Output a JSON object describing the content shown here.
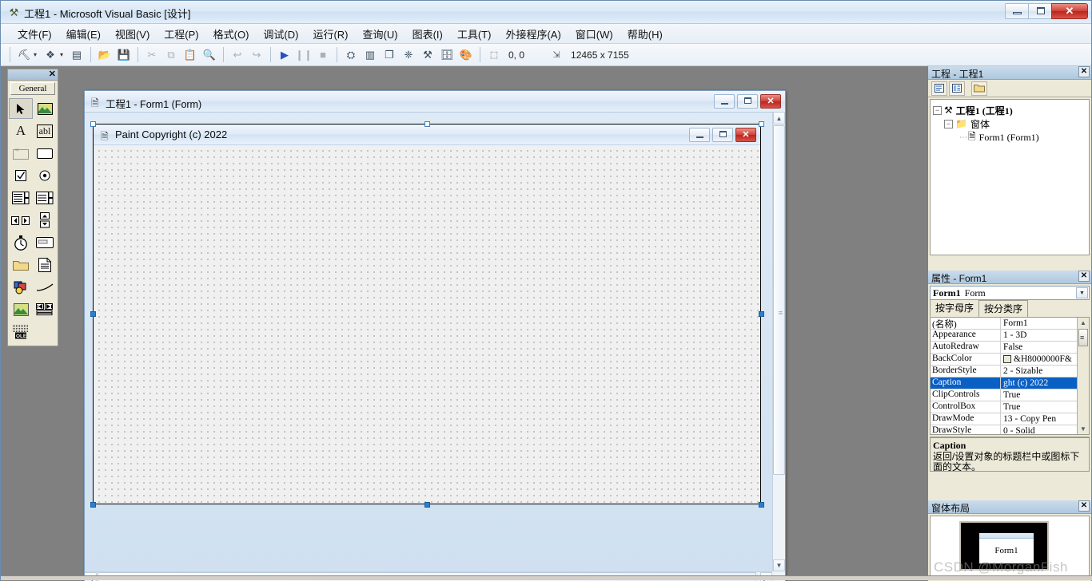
{
  "window": {
    "title": "工程1 - Microsoft Visual Basic [设计]",
    "icon": "vb-app-icon",
    "minimize_label": "",
    "maximize_label": "",
    "close_label": "✕"
  },
  "menubar": {
    "items": [
      {
        "label": "文件(F)",
        "name": "menu-file"
      },
      {
        "label": "编辑(E)",
        "name": "menu-edit"
      },
      {
        "label": "视图(V)",
        "name": "menu-view"
      },
      {
        "label": "工程(P)",
        "name": "menu-project"
      },
      {
        "label": "格式(O)",
        "name": "menu-format"
      },
      {
        "label": "调试(D)",
        "name": "menu-debug"
      },
      {
        "label": "运行(R)",
        "name": "menu-run"
      },
      {
        "label": "查询(U)",
        "name": "menu-query"
      },
      {
        "label": "图表(I)",
        "name": "menu-diagram"
      },
      {
        "label": "工具(T)",
        "name": "menu-tools"
      },
      {
        "label": "外接程序(A)",
        "name": "menu-addins"
      },
      {
        "label": "窗口(W)",
        "name": "menu-window"
      },
      {
        "label": "帮助(H)",
        "name": "menu-help"
      }
    ]
  },
  "toolbar": {
    "buttons": [
      {
        "name": "add-project-button",
        "glyph": "⛏",
        "dim": false,
        "dropdown": true
      },
      {
        "name": "add-form-button",
        "glyph": "❖",
        "dim": false,
        "dropdown": true
      },
      {
        "name": "menu-editor-button",
        "glyph": "▤",
        "dim": false,
        "dropdown": false
      },
      {
        "name": "open-project-button",
        "glyph": "📂",
        "dim": false,
        "dropdown": false
      },
      {
        "name": "save-project-button",
        "glyph": "💾",
        "dim": false,
        "dropdown": false
      },
      {
        "name": "cut-button",
        "glyph": "✂",
        "dim": true,
        "dropdown": false
      },
      {
        "name": "copy-button",
        "glyph": "⧉",
        "dim": true,
        "dropdown": false
      },
      {
        "name": "paste-button",
        "glyph": "📋",
        "dim": true,
        "dropdown": false
      },
      {
        "name": "find-button",
        "glyph": "🔍",
        "dim": true,
        "dropdown": false
      },
      {
        "name": "undo-button",
        "glyph": "↩",
        "dim": true,
        "dropdown": false
      },
      {
        "name": "redo-button",
        "glyph": "↪",
        "dim": true,
        "dropdown": false
      },
      {
        "name": "start-button",
        "glyph": "▶",
        "dim": false,
        "dropdown": false
      },
      {
        "name": "break-button",
        "glyph": "❙❙",
        "dim": true,
        "dropdown": false
      },
      {
        "name": "end-button",
        "glyph": "■",
        "dim": true,
        "dropdown": false
      },
      {
        "name": "project-explorer-button",
        "glyph": "⛭",
        "dim": false,
        "dropdown": false
      },
      {
        "name": "properties-window-button",
        "glyph": "▥",
        "dim": false,
        "dropdown": false
      },
      {
        "name": "form-layout-button",
        "glyph": "❐",
        "dim": false,
        "dropdown": false
      },
      {
        "name": "object-browser-button",
        "glyph": "❈",
        "dim": false,
        "dropdown": false
      },
      {
        "name": "toolbox-button",
        "glyph": "⚒",
        "dim": false,
        "dropdown": false
      },
      {
        "name": "data-view-button",
        "glyph": "🗄",
        "dim": false,
        "dropdown": false
      },
      {
        "name": "visual-component-manager-button",
        "glyph": "🎨",
        "dim": false,
        "dropdown": false
      }
    ],
    "position_icon": "position-icon",
    "position_value": "0, 0",
    "size_icon": "size-icon",
    "size_value": "12465 x 7155"
  },
  "toolbox": {
    "panel_title": "",
    "close_label": "✕",
    "tab_label": "General",
    "tools": [
      {
        "name": "tool-pointer",
        "glyph": "➚",
        "selected": true
      },
      {
        "name": "tool-picturebox",
        "glyph": "🖼",
        "selected": false
      },
      {
        "name": "tool-label",
        "glyph": "A",
        "selected": false
      },
      {
        "name": "tool-textbox",
        "glyph": "abl",
        "selected": false
      },
      {
        "name": "tool-frame",
        "glyph": "xy",
        "selected": false
      },
      {
        "name": "tool-commandbutton",
        "glyph": "▭",
        "selected": false
      },
      {
        "name": "tool-checkbox",
        "glyph": "☑",
        "selected": false
      },
      {
        "name": "tool-optionbutton",
        "glyph": "◉",
        "selected": false
      },
      {
        "name": "tool-combobox",
        "glyph": "▤",
        "selected": false
      },
      {
        "name": "tool-listbox",
        "glyph": "▤",
        "selected": false
      },
      {
        "name": "tool-hscrollbar",
        "glyph": "◀▶",
        "selected": false
      },
      {
        "name": "tool-vscrollbar",
        "glyph": "▲▼",
        "selected": false
      },
      {
        "name": "tool-timer",
        "glyph": "⏱",
        "selected": false
      },
      {
        "name": "tool-drivelistbox",
        "glyph": "▤",
        "selected": false
      },
      {
        "name": "tool-dirlistbox",
        "glyph": "📁",
        "selected": false
      },
      {
        "name": "tool-filelistbox",
        "glyph": "📄",
        "selected": false
      },
      {
        "name": "tool-shape",
        "glyph": "◔",
        "selected": false
      },
      {
        "name": "tool-line",
        "glyph": "╲",
        "selected": false
      },
      {
        "name": "tool-image",
        "glyph": "🖼",
        "selected": false
      },
      {
        "name": "tool-data",
        "glyph": "◀▶",
        "selected": false
      },
      {
        "name": "tool-ole",
        "glyph": "OLE",
        "selected": false
      }
    ]
  },
  "designer": {
    "window_title": "工程1 - Form1 (Form)",
    "window_icon": "form-document-icon",
    "minimize_label": "",
    "maximize_label": "",
    "close_label": "✕",
    "form": {
      "caption": "Paint Copyright (c) 2022",
      "icon": "form-document-icon",
      "minimize_label": "",
      "maximize_label": "",
      "close_label": "✕"
    }
  },
  "project_explorer": {
    "title": "工程 - 工程1",
    "close_label": "✕",
    "toolbar_buttons": [
      {
        "name": "view-code-button",
        "glyph": "▤"
      },
      {
        "name": "view-object-button",
        "glyph": "▥"
      },
      {
        "name": "toggle-folders-button",
        "glyph": "📁"
      }
    ],
    "tree": [
      {
        "name": "tree-node-project",
        "label": "工程1 (工程1)",
        "icon": "project-icon",
        "expander": "-",
        "level": 0,
        "bold": true
      },
      {
        "name": "tree-node-forms-folder",
        "label": "窗体",
        "icon": "folder-icon",
        "expander": "-",
        "level": 1,
        "bold": false
      },
      {
        "name": "tree-node-form1",
        "label": "Form1 (Form1)",
        "icon": "form-document-icon",
        "expander": "",
        "level": 2,
        "bold": false
      }
    ]
  },
  "properties": {
    "title": "属性 - Form1",
    "close_label": "✕",
    "object_name": "Form1",
    "object_type": "Form",
    "dropdown_glyph": "▼",
    "tabs": [
      {
        "name": "tab-alphabetic",
        "label": "按字母序",
        "active": true
      },
      {
        "name": "tab-categorized",
        "label": "按分类序",
        "active": false
      }
    ],
    "rows": [
      {
        "name": "(名称)",
        "value": "Form1",
        "selected": false,
        "swatch": null
      },
      {
        "name": "Appearance",
        "value": "1 - 3D",
        "selected": false,
        "swatch": null
      },
      {
        "name": "AutoRedraw",
        "value": "False",
        "selected": false,
        "swatch": null
      },
      {
        "name": "BackColor",
        "value": "&H8000000F&",
        "selected": false,
        "swatch": "#ece9d8"
      },
      {
        "name": "BorderStyle",
        "value": "2 - Sizable",
        "selected": false,
        "swatch": null
      },
      {
        "name": "Caption",
        "value": "ght (c) 2022",
        "selected": true,
        "swatch": null
      },
      {
        "name": "ClipControls",
        "value": "True",
        "selected": false,
        "swatch": null
      },
      {
        "name": "ControlBox",
        "value": "True",
        "selected": false,
        "swatch": null
      },
      {
        "name": "DrawMode",
        "value": "13 - Copy Pen",
        "selected": false,
        "swatch": null
      },
      {
        "name": "DrawStyle",
        "value": "0 - Solid",
        "selected": false,
        "swatch": null
      }
    ],
    "description": {
      "title": "Caption",
      "body": "返回/设置对象的标题栏中或图标下面的文本。"
    },
    "scroll_up_glyph": "▲",
    "scroll_down_glyph": "▼"
  },
  "form_layout": {
    "title": "窗体布局",
    "close_label": "✕",
    "form_label": "Form1"
  },
  "watermark": "CSDN @MorganFish",
  "colors": {
    "accent_blue": "#0a5fc4",
    "title_gradient_top": "#eaf2fb",
    "close_red": "#cf433a",
    "panel_face": "#ece9d8",
    "workspace_gray": "#808080"
  }
}
